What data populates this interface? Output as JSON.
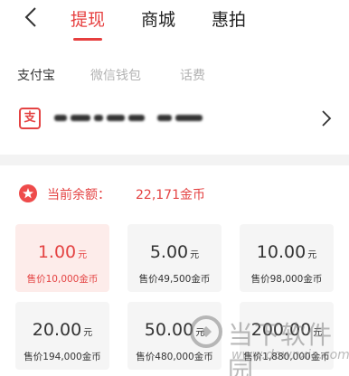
{
  "nav": {
    "tabs": [
      {
        "label": "提现",
        "active": true
      },
      {
        "label": "商城",
        "active": false
      },
      {
        "label": "惠拍",
        "active": false
      }
    ]
  },
  "subtabs": [
    {
      "label": "支付宝",
      "active": true
    },
    {
      "label": "微信钱包",
      "active": false
    },
    {
      "label": "话费",
      "active": false
    }
  ],
  "account": {
    "icon": "alipay-icon",
    "icon_glyph": "支",
    "value_obscured": true
  },
  "balance": {
    "label": "当前余额：",
    "value": "22,171金币"
  },
  "options": [
    {
      "amount": "1.00",
      "unit": "元",
      "price": "售价10,000金币",
      "selected": true
    },
    {
      "amount": "5.00",
      "unit": "元",
      "price": "售价49,500金币",
      "selected": false
    },
    {
      "amount": "10.00",
      "unit": "元",
      "price": "售价98,000金币",
      "selected": false
    },
    {
      "amount": "20.00",
      "unit": "元",
      "price": "售价194,000金币",
      "selected": false
    },
    {
      "amount": "50.00",
      "unit": "元",
      "price": "售价480,000金币",
      "selected": false
    },
    {
      "amount": "200.00",
      "unit": "元",
      "price": "售价1,880,000金币",
      "selected": false
    }
  ],
  "watermark": {
    "text": "当下软件园",
    "url": "www.downxia.com"
  },
  "colors": {
    "accent": "#e63f3f",
    "selected_bg": "#fdecea",
    "card_bg": "#f5f5f5",
    "divider": "#f3f3f3"
  }
}
